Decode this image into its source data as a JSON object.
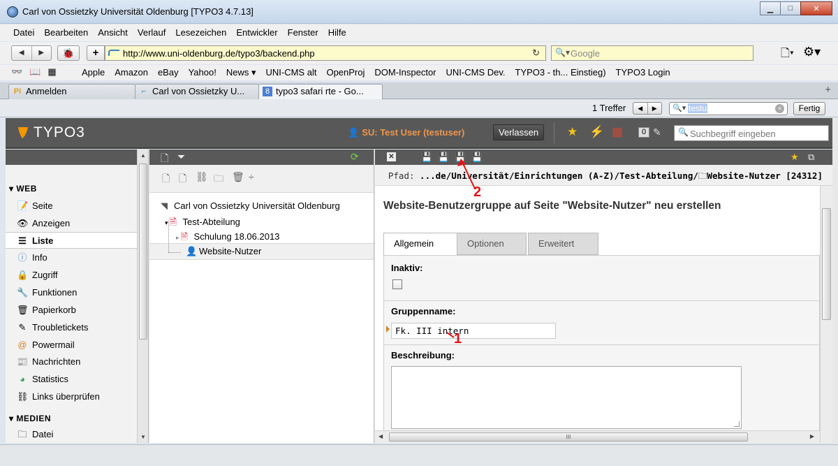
{
  "window": {
    "title": "Carl von Ossietzky Universität Oldenburg [TYPO3 4.7.13]",
    "minimize": "▁",
    "maximize": "□",
    "close": "✕"
  },
  "menu": [
    "Datei",
    "Bearbeiten",
    "Ansicht",
    "Verlauf",
    "Lesezeichen",
    "Entwickler",
    "Fenster",
    "Hilfe"
  ],
  "navigation": {
    "back": "◀",
    "forward": "▶",
    "bug": "🐞",
    "add": "+",
    "url": "http://www.uni-oldenburg.de/typo3/backend.php",
    "reload": "↻",
    "search_placeholder": "Google",
    "page_icon": "🗋▾",
    "gear_icon": "⚙▾"
  },
  "bookmarks": {
    "icons": "👓📖▦",
    "items": [
      "Apple",
      "Amazon",
      "eBay",
      "Yahoo!",
      "News ▾",
      "UNI-CMS alt",
      "OpenProj",
      "DOM-Inspector",
      "UNI-CMS Dev.",
      "TYPO3 - th... Einstieg)",
      "TYPO3 Login"
    ]
  },
  "tabs": [
    {
      "label": "Anmelden",
      "icon": "Pi"
    },
    {
      "label": "Carl von Ossietzky U...",
      "icon": "⌐"
    },
    {
      "label": "typo3 safari rte - Go...",
      "icon": "8"
    }
  ],
  "tab_plus": "+",
  "findbar": {
    "count": "1 Treffer",
    "prev": "◀",
    "next": "▶",
    "query": "testu",
    "clear": "×",
    "done": "Fertig"
  },
  "typo3": {
    "logo": "TYPO3",
    "user": "SU: Test User (testuser)",
    "logout": "Verlassen",
    "badge": "0",
    "search_placeholder": "Suchbegriff eingeben"
  },
  "modules": {
    "groups": [
      {
        "label": "▾ WEB"
      },
      {
        "label": "▾ MEDIEN"
      }
    ],
    "items": [
      {
        "label": "Seite",
        "icon": "📝"
      },
      {
        "label": "Anzeigen",
        "icon": "👁"
      },
      {
        "label": "Liste",
        "icon": "☰"
      },
      {
        "label": "Info",
        "icon": "ⓘ"
      },
      {
        "label": "Zugriff",
        "icon": "🔒"
      },
      {
        "label": "Funktionen",
        "icon": "🔧"
      },
      {
        "label": "Papierkorb",
        "icon": "🗑"
      },
      {
        "label": "Troubletickets",
        "icon": "✎"
      },
      {
        "label": "Powermail",
        "icon": "@"
      },
      {
        "label": "Nachrichten",
        "icon": "📰"
      },
      {
        "label": "Statistics",
        "icon": "◕"
      },
      {
        "label": "Links überprüfen",
        "icon": "⛓"
      },
      {
        "label": "Datei",
        "icon": "🗀"
      }
    ]
  },
  "pagetree": {
    "root": "Carl von Ossietzky Universität Oldenburg",
    "nodes": [
      "Test-Abteilung",
      "Schulung 18.06.2013",
      "Website-Nutzer"
    ]
  },
  "content": {
    "path_label": "Pfad:",
    "path_value": "...de/Universität/Einrichtungen (A-Z)/Test-Abteilung/",
    "path_page": "Website-Nutzer [24312]",
    "heading": "Website-Benutzergruppe auf Seite \"Website-Nutzer\" neu erstellen",
    "tabs": [
      "Allgemein",
      "Optionen",
      "Erweitert"
    ],
    "fields": {
      "inactive_label": "Inaktiv:",
      "groupname_label": "Gruppenname:",
      "groupname_value": "Fk. III intern",
      "description_label": "Beschreibung:"
    }
  },
  "annotations": {
    "one": "1",
    "two": "2"
  },
  "colors": {
    "typo3_header": "#585858",
    "typo3_orange": "#f0954a",
    "annotation_red": "#e01414",
    "url_bg": "#fdfacb"
  }
}
